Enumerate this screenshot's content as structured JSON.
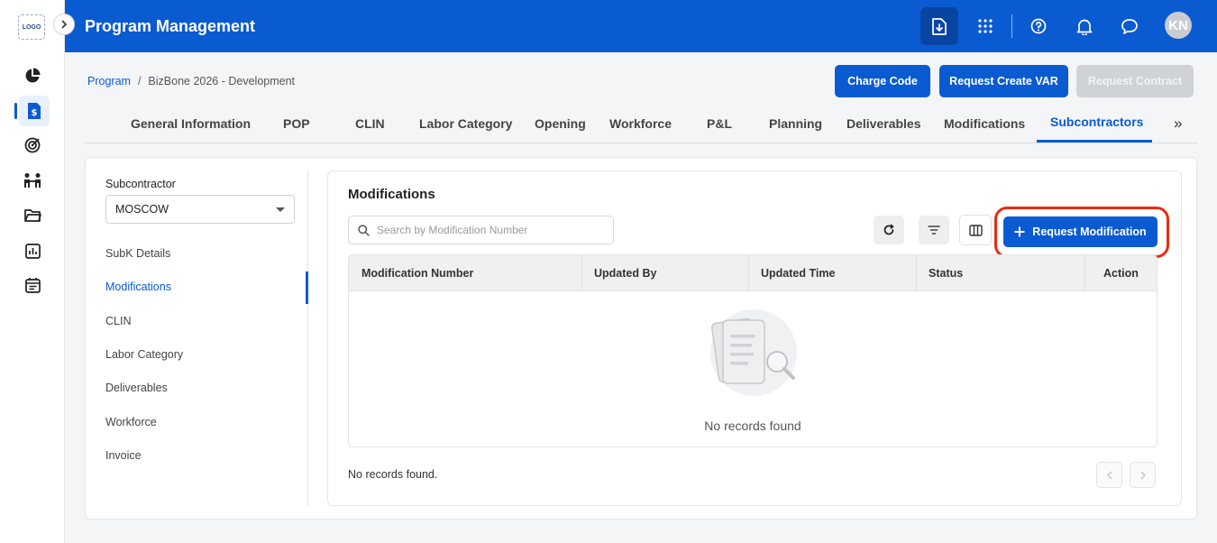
{
  "rail": {
    "logo_text": "LOGO",
    "icons": [
      "pie-chart-icon",
      "dollar-document-icon",
      "target-icon",
      "team-icon",
      "folder-icon",
      "report-icon",
      "calendar-icon"
    ]
  },
  "header": {
    "title": "Program Management",
    "avatar_initials": "KN",
    "icons": [
      "download-document-icon",
      "apps-grid-icon",
      "help-icon",
      "bell-icon",
      "chat-icon"
    ]
  },
  "breadcrumb": {
    "root": "Program",
    "separator": "/",
    "current": "BizBone 2026 - Development"
  },
  "actions": {
    "charge_code": "Charge Code",
    "request_create_var": "Request Create VAR",
    "request_contract": "Request Contract"
  },
  "tabs": [
    {
      "label": "General Information"
    },
    {
      "label": "POP"
    },
    {
      "label": "CLIN"
    },
    {
      "label": "Labor Category"
    },
    {
      "label": "Opening"
    },
    {
      "label": "Workforce"
    },
    {
      "label": "P&L"
    },
    {
      "label": "Planning"
    },
    {
      "label": "Deliverables"
    },
    {
      "label": "Modifications"
    },
    {
      "label": "Subcontractors"
    }
  ],
  "tabs_more": "»",
  "active_tab": "Subcontractors",
  "sidebar": {
    "subcontractor_label": "Subcontractor",
    "subcontractor_value": "MOSCOW",
    "items": [
      {
        "label": "SubK Details"
      },
      {
        "label": "Modifications"
      },
      {
        "label": "CLIN"
      },
      {
        "label": "Labor Category"
      },
      {
        "label": "Deliverables"
      },
      {
        "label": "Workforce"
      },
      {
        "label": "Invoice"
      }
    ],
    "active_item": "Modifications"
  },
  "panel": {
    "title": "Modifications",
    "search_placeholder": "Search by Modification Number",
    "request_button": "Request Modification",
    "columns": [
      "Modification Number",
      "Updated By",
      "Updated Time",
      "Status",
      "Action"
    ],
    "empty_message": "No records found",
    "footer": "No records found."
  },
  "colors": {
    "primary": "#0a5bd1",
    "highlight": "#ee2a12"
  }
}
